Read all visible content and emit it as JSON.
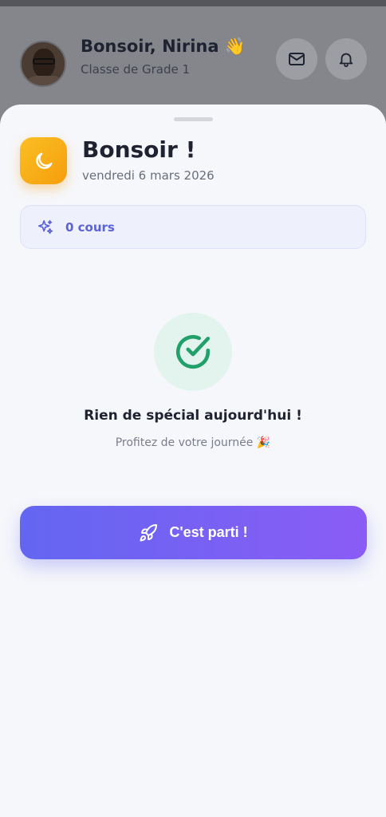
{
  "header": {
    "greeting": "Bonsoir, Nirina 👋",
    "grade": "Classe de Grade 1",
    "icons": [
      "mail-icon",
      "bell-icon"
    ]
  },
  "sheet": {
    "title": "Bonsoir !",
    "date": "vendredi 6 mars 2026",
    "courses_label": "0 cours",
    "empty_title": "Rien de spécial aujourd'hui !",
    "empty_subtitle": "Profitez de votre journée 🎉",
    "cta_label": "C'est parti !"
  },
  "colors": {
    "accent": "#6366f1",
    "accent_end": "#8b5cf6",
    "moon_badge": "#f59e0b",
    "success": "#22a06b"
  }
}
